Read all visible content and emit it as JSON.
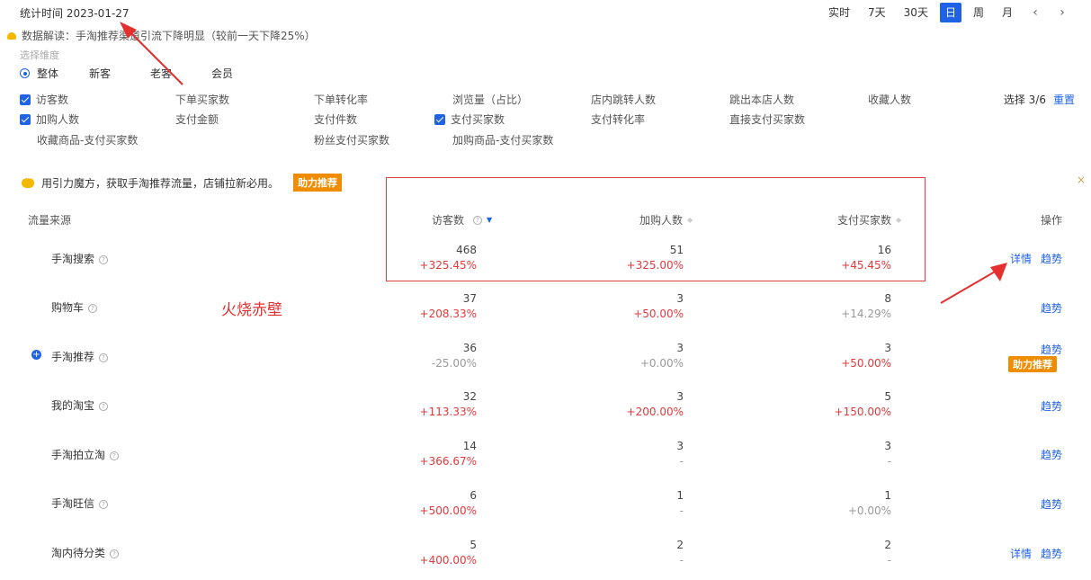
{
  "header": {
    "stat_time": "统计时间 2023-01-27",
    "periods": [
      {
        "label": "实时",
        "active": false
      },
      {
        "label": "7天",
        "active": false
      },
      {
        "label": "30天",
        "active": false
      },
      {
        "label": "日",
        "active": true
      },
      {
        "label": "周",
        "active": false
      },
      {
        "label": "月",
        "active": false
      }
    ],
    "prev_icon": "‹",
    "next_icon": "›"
  },
  "insight": {
    "text": "数据解读：手淘推荐渠道引流下降明显（较前一天下降25%）"
  },
  "dimension": {
    "label": "选择维度",
    "options": [
      "整体",
      "新客",
      "老客",
      "会员"
    ],
    "selected": "整体"
  },
  "metrics": {
    "items": [
      {
        "label": "访客数",
        "checked": true
      },
      {
        "label": "下单买家数",
        "checked": false
      },
      {
        "label": "下单转化率",
        "checked": false
      },
      {
        "label": "浏览量（占比）",
        "checked": false
      },
      {
        "label": "店内跳转人数",
        "checked": false
      },
      {
        "label": "跳出本店人数",
        "checked": false
      },
      {
        "label": "收藏人数",
        "checked": false
      },
      {
        "label": "加购人数",
        "checked": true
      },
      {
        "label": "支付金额",
        "checked": false
      },
      {
        "label": "支付件数",
        "checked": false
      },
      {
        "label": "支付买家数",
        "checked": true
      },
      {
        "label": "支付转化率",
        "checked": false
      },
      {
        "label": "直接支付买家数",
        "checked": false
      },
      {
        "label": "收藏商品-支付买家数",
        "checked": false
      },
      {
        "label": "粉丝支付买家数",
        "checked": false
      },
      {
        "label": "加购商品-支付买家数",
        "checked": false
      }
    ],
    "select_count": "选择 3/6",
    "reset_label": "重置"
  },
  "promo": {
    "text": "用引力魔方，获取手淘推荐流量，店铺拉新必用。",
    "button": "助力推荐",
    "close": "×"
  },
  "table": {
    "headers": {
      "source": "流量来源",
      "visitors": "访客数",
      "add_cart": "加购人数",
      "pay_buyers": "支付买家数",
      "action": "操作"
    },
    "rows": [
      {
        "name": "手淘搜索",
        "visitors": "468",
        "visitors_pct": "+325.45%",
        "cart": "51",
        "cart_pct": "+325.00%",
        "pay": "16",
        "pay_pct": "+45.45%",
        "detail": "详情",
        "trend": "趋势"
      },
      {
        "name": "购物车",
        "visitors": "37",
        "visitors_pct": "+208.33%",
        "cart": "3",
        "cart_pct": "+50.00%",
        "pay": "8",
        "pay_pct": "+14.29%",
        "detail": "",
        "trend": "趋势"
      },
      {
        "name": "手淘推荐",
        "visitors": "36",
        "visitors_pct": "-25.00%",
        "cart": "3",
        "cart_pct": "+0.00%",
        "pay": "3",
        "pay_pct": "+50.00%",
        "detail": "",
        "trend": "趋势",
        "assist": "助力推荐"
      },
      {
        "name": "我的淘宝",
        "visitors": "32",
        "visitors_pct": "+113.33%",
        "cart": "3",
        "cart_pct": "+200.00%",
        "pay": "5",
        "pay_pct": "+150.00%",
        "detail": "",
        "trend": "趋势"
      },
      {
        "name": "手淘拍立淘",
        "visitors": "14",
        "visitors_pct": "+366.67%",
        "cart": "3",
        "cart_pct": "-",
        "pay": "3",
        "pay_pct": "-",
        "detail": "",
        "trend": "趋势"
      },
      {
        "name": "手淘旺信",
        "visitors": "6",
        "visitors_pct": "+500.00%",
        "cart": "1",
        "cart_pct": "-",
        "pay": "1",
        "pay_pct": "+0.00%",
        "detail": "",
        "trend": "趋势"
      },
      {
        "name": "淘内待分类",
        "visitors": "5",
        "visitors_pct": "+400.00%",
        "cart": "2",
        "cart_pct": "-",
        "pay": "2",
        "pay_pct": "-",
        "detail": "详情",
        "trend": "趋势"
      }
    ]
  },
  "watermark": "火烧赤壁",
  "colors": {
    "accent": "#1f62e6",
    "positive": "#e5383b",
    "neutral": "#999999",
    "promo": "#f08c00"
  }
}
